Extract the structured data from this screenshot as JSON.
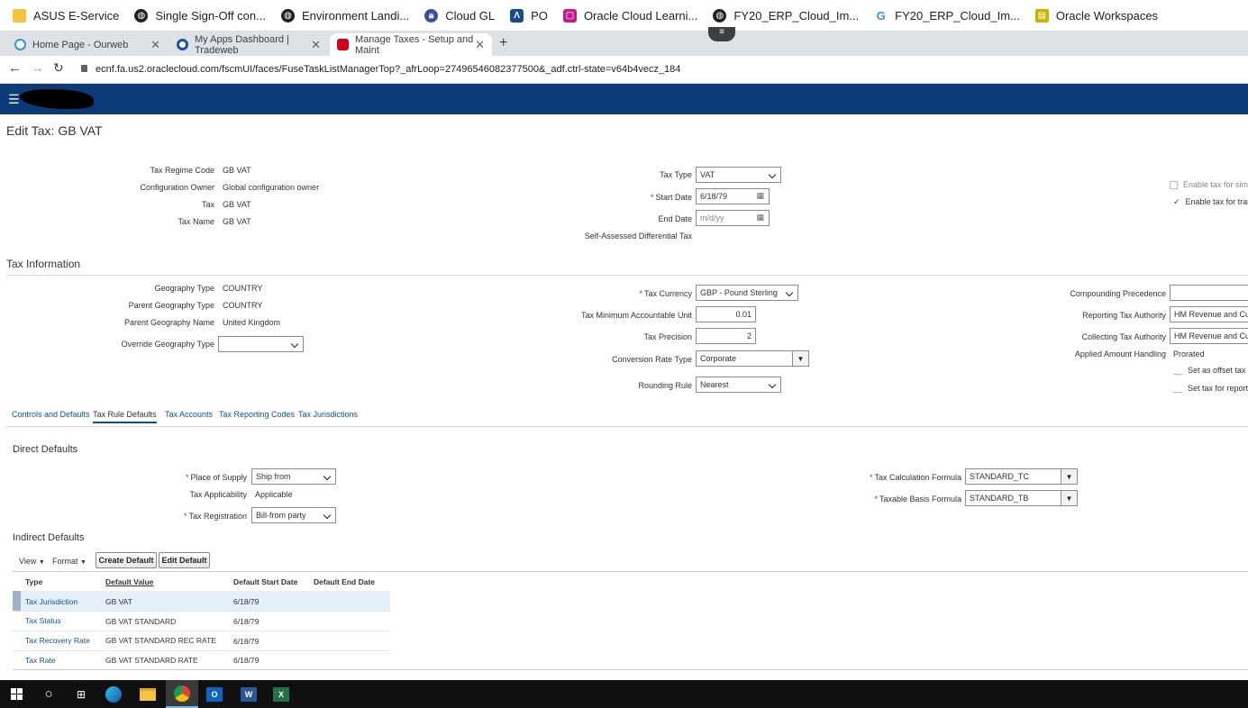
{
  "bookmarks": [
    {
      "label": "ASUS E-Service",
      "icon": "folder-icon",
      "color": "#f5c542"
    },
    {
      "label": "Single Sign-Off con...",
      "icon": "globe-icon",
      "color": "#202124"
    },
    {
      "label": "Environment Landi...",
      "icon": "globe-icon",
      "color": "#202124"
    },
    {
      "label": "Cloud GL",
      "icon": "lock-icon",
      "color": "#3b4fa0"
    },
    {
      "label": "PO",
      "icon": "chevron-up-icon",
      "color": "#1a4a8a"
    },
    {
      "label": "Oracle Cloud Learni...",
      "icon": "oracle-icon",
      "color": "#c61b8b"
    },
    {
      "label": "FY20_ERP_Cloud_Im...",
      "icon": "globe-icon",
      "color": "#202124"
    },
    {
      "label": "FY20_ERP_Cloud_Im...",
      "icon": "google-icon",
      "color": "#4285f4"
    },
    {
      "label": "Oracle Workspaces",
      "icon": "workspaces-icon",
      "color": "#c8b400"
    }
  ],
  "tabs": [
    {
      "label": "Home Page - Ourweb",
      "color": "#2e9bd6"
    },
    {
      "label": "My Apps Dashboard | Tradeweb",
      "color": "#1f4fa8"
    },
    {
      "label": "Manage Taxes - Setup and Maint",
      "color": "#d0021b"
    }
  ],
  "address": {
    "url": "ecnf.fa.us2.oraclecloud.com/fscmUI/faces/FuseTaskListManagerTop?_afrLoop=27496546082377500&_adf.ctrl-state=v64b4vecz_184"
  },
  "page": {
    "title": "Edit Tax: GB VAT"
  },
  "header_info": {
    "tax_regime_code_label": "Tax Regime Code",
    "tax_regime_code": "GB VAT",
    "config_owner_label": "Configuration Owner",
    "config_owner": "Global configuration owner",
    "tax_label": "Tax",
    "tax": "GB VAT",
    "tax_name_label": "Tax Name",
    "tax_name": "GB VAT",
    "tax_type_label": "Tax Type",
    "tax_type": "VAT",
    "start_date_label": "Start Date",
    "start_date": "6/18/79",
    "end_date_label": "End Date",
    "end_date_placeholder": "m/d/yy",
    "self_assessed_label": "Self-Assessed Differential Tax",
    "enable_simulation_label": "Enable tax for simul",
    "enable_transactions_label": "Enable tax for trans"
  },
  "tax_information": {
    "section_title": "Tax Information",
    "geography_type_label": "Geography Type",
    "geography_type": "COUNTRY",
    "parent_geo_type_label": "Parent Geography Type",
    "parent_geo_type": "COUNTRY",
    "parent_geo_name_label": "Parent Geography Name",
    "parent_geo_name": "United Kingdom",
    "override_geo_type_label": "Override Geography Type",
    "override_geo_type": "",
    "tax_currency_label": "Tax Currency",
    "tax_currency": "GBP - Pound Sterling",
    "min_unit_label": "Tax Minimum Accountable Unit",
    "min_unit": "0.01",
    "precision_label": "Tax Precision",
    "precision": "2",
    "conversion_rate_label": "Conversion Rate Type",
    "conversion_rate": "Corporate",
    "rounding_label": "Rounding Rule",
    "rounding": "Nearest",
    "compounding_label": "Compounding Precedence",
    "compounding": "",
    "reporting_authority_label": "Reporting Tax Authority",
    "reporting_authority": "HM Revenue and Cust",
    "collecting_authority_label": "Collecting Tax Authority",
    "collecting_authority": "HM Revenue and Cust",
    "applied_amount_label": "Applied Amount Handling",
    "applied_amount": "Prorated",
    "offset_label": "Set as offset tax",
    "reporting_only_label": "Set tax for reporting"
  },
  "subtabs": [
    "Controls and Defaults",
    "Tax Rule Defaults",
    "Tax Accounts",
    "Tax Reporting Codes",
    "Tax Jurisdictions"
  ],
  "direct_defaults": {
    "title": "Direct Defaults",
    "place_of_supply_label": "Place of Supply",
    "place_of_supply": "Ship from",
    "tax_applicability_label": "Tax Applicability",
    "tax_applicability": "Applicable",
    "tax_registration_label": "Tax Registration",
    "tax_registration": "Bill-from party",
    "calc_formula_label": "Tax Calculation Formula",
    "calc_formula": "STANDARD_TC",
    "basis_formula_label": "Taxable Basis Formula",
    "basis_formula": "STANDARD_TB"
  },
  "indirect_defaults": {
    "title": "Indirect Defaults",
    "view_label": "View",
    "format_label": "Format",
    "create_label": "Create Default",
    "edit_label": "Edit Default",
    "columns": [
      "Type",
      "Default Value",
      "Default Start Date",
      "Default End Date"
    ],
    "rows": [
      {
        "type": "Tax Jurisdiction",
        "value": "GB VAT",
        "start": "6/18/79",
        "end": ""
      },
      {
        "type": "Tax Status",
        "value": "GB VAT STANDARD",
        "start": "6/18/79",
        "end": ""
      },
      {
        "type": "Tax Recovery Rate",
        "value": "GB VAT STANDARD REC RATE",
        "start": "6/18/79",
        "end": ""
      },
      {
        "type": "Tax Rate",
        "value": "GB VAT STANDARD RATE",
        "start": "6/18/79",
        "end": ""
      }
    ]
  },
  "taskbar": [
    "windows-start-icon",
    "search-icon",
    "task-view-icon",
    "edge-icon",
    "file-explorer-icon",
    "chrome-icon",
    "outlook-icon",
    "word-icon",
    "excel-icon"
  ]
}
